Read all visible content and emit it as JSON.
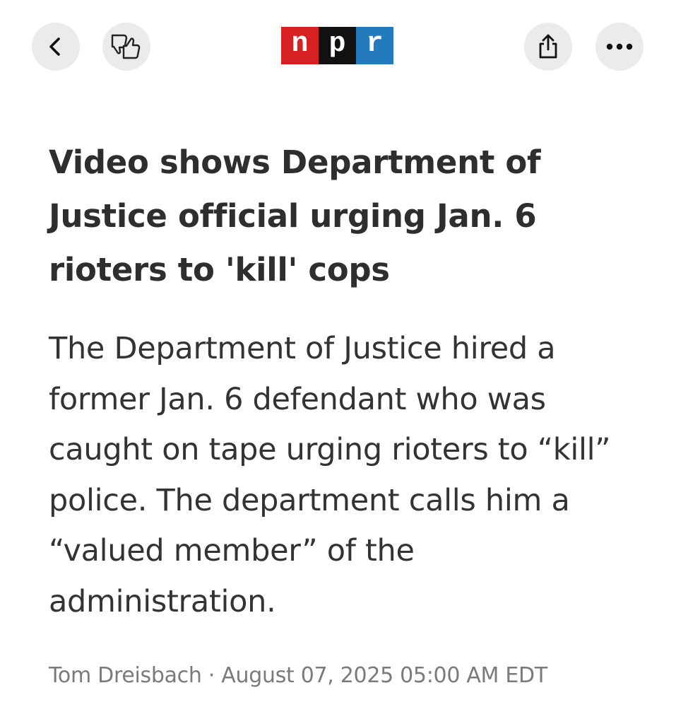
{
  "header": {
    "back_icon": "chevron-left-icon",
    "reactions_icon": "thumbs-up-down-icon",
    "logo": {
      "letters": [
        "n",
        "p",
        "r"
      ],
      "colors": [
        "#d62021",
        "#111111",
        "#237bbd"
      ]
    },
    "share_icon": "share-icon",
    "more_icon": "ellipsis-icon"
  },
  "article": {
    "headline": "Video shows Department of Justice official urging Jan. 6 rioters to 'kill' cops",
    "summary": "The Department of Justice hired a former Jan. 6 defendant who was caught on tape urging rioters to “kill” police. The department calls him a “valued member” of the administration.",
    "author": "Tom Dreisbach",
    "separator": " · ",
    "date": "August 07, 2025 05:00 AM EDT"
  }
}
